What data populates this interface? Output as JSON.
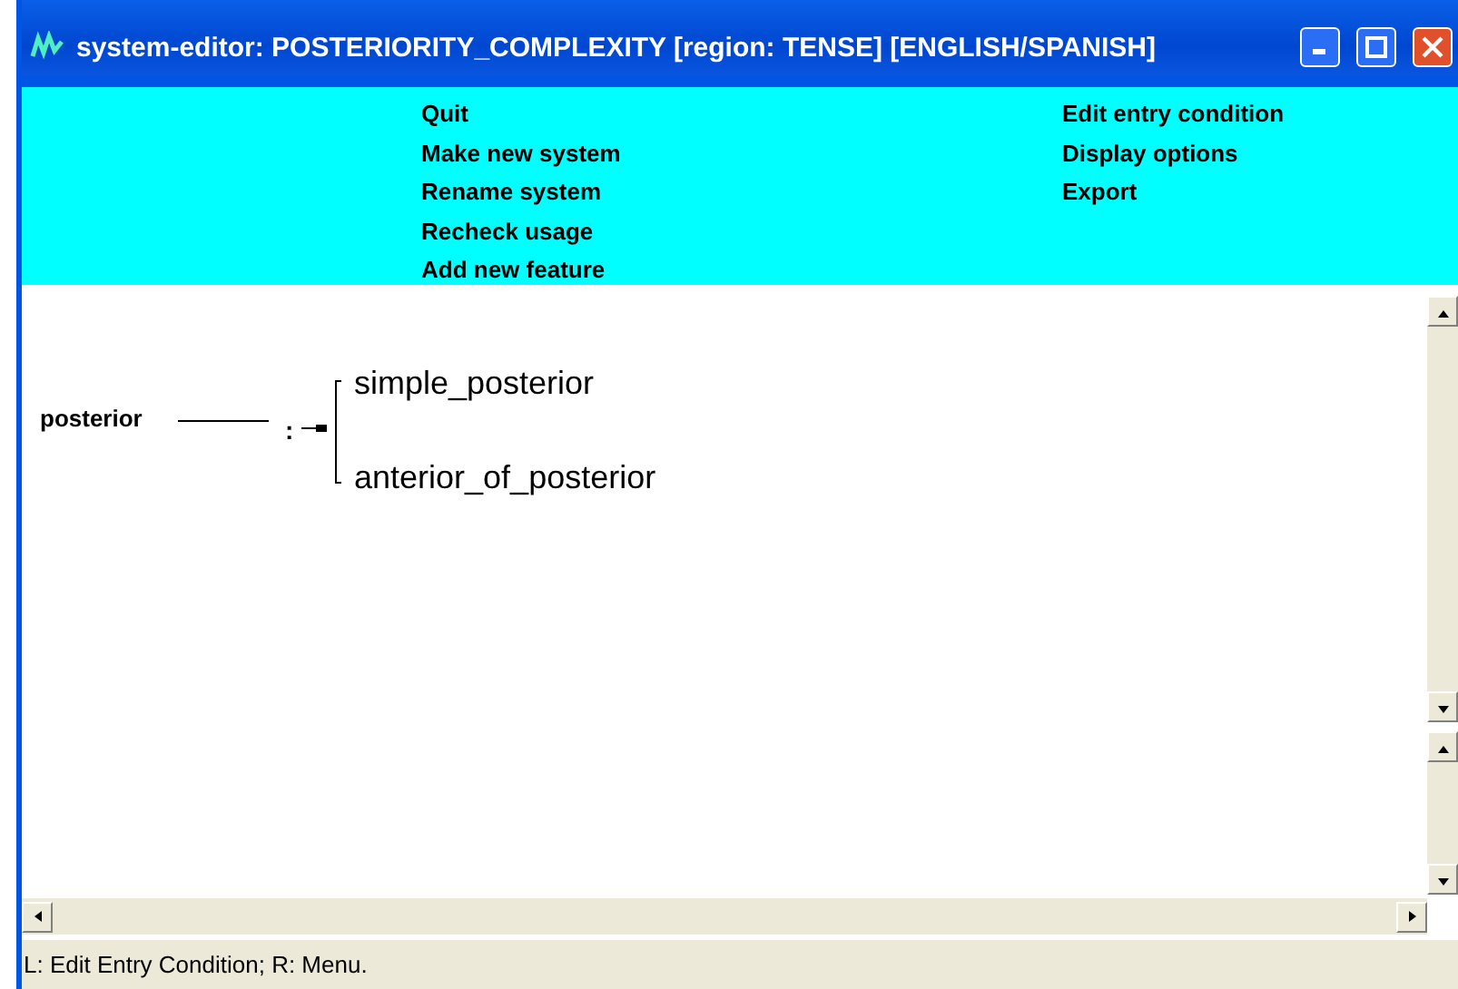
{
  "window": {
    "title": "system-editor: POSTERIORITY_COMPLEXITY [region:  TENSE] [ENGLISH/SPANISH]"
  },
  "menu": {
    "columns": [
      [
        "Quit",
        "Make new system",
        "Rename system",
        "Recheck usage",
        "Add new feature"
      ],
      [
        "Edit entry condition",
        "Display options",
        "Export"
      ]
    ]
  },
  "diagram": {
    "root": "posterior",
    "connector": ":",
    "options": [
      "simple_posterior",
      "anterior_of_posterior"
    ]
  },
  "status_bar": "L: Edit Entry Condition; R: Menu."
}
